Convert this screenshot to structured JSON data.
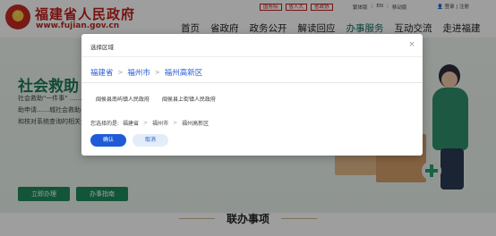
{
  "header": {
    "site_title": "福建省人民政府",
    "site_url": "www.fujian.gov.cn",
    "badges": [
      "国务院",
      "省人大",
      "省政协"
    ],
    "top_links": [
      "繁体版",
      "EN",
      "移动版",
      "登录",
      "注册"
    ],
    "nav": [
      "首页",
      "省政府",
      "政务公开",
      "解读回应",
      "办事服务",
      "互动交流",
      "走进福建"
    ],
    "active_nav": "办事服务"
  },
  "hero": {
    "title": "社会救助",
    "text": "社会救助\"一件事\" ……化业务流程、强化数据……动\"一次办\"，依托……员救助供养、急难型临……孩福建省救助申请……城社会救助事项申请\"一张表单、一套材料、一次提交、多方复用\"，全面取消可以通过政务服务平台和核对系统查询的相关证明材料。",
    "btn_apply": "立即办理",
    "btn_guide": "办事指南",
    "lian_title": "联办事项"
  },
  "modal": {
    "title": "选择区域",
    "close": "×",
    "breadcrumb": [
      "福建省",
      "福州市",
      "福州高新区"
    ],
    "options": [
      "闽侯县南屿镇人民政府",
      "闽侯县上街镇人民政府"
    ],
    "selected_label": "您选择的是:",
    "selected_path": [
      "福建省",
      "福州市",
      "福州高新区"
    ],
    "ok_label": "确认",
    "cancel_label": "取消"
  },
  "colors": {
    "brand_red": "#c0201b",
    "nav_active": "#0d6b64",
    "link_blue": "#2a5bd7",
    "button_blue": "#1f5bd6",
    "hero_green": "#1f7a55"
  }
}
